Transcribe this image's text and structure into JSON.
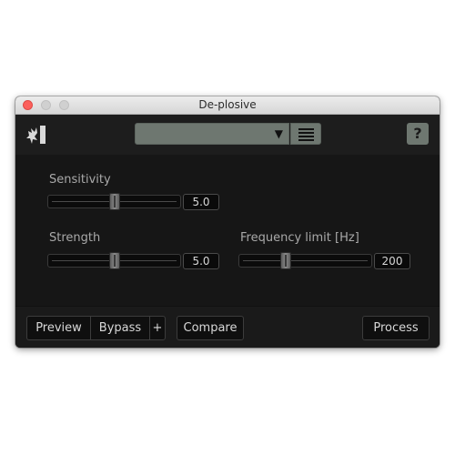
{
  "window": {
    "title": "De-plosive"
  },
  "toolbar": {
    "preset_value": "",
    "preset_arrow": "▼",
    "help_label": "?"
  },
  "controls": {
    "sensitivity": {
      "label": "Sensitivity",
      "value": "5.0",
      "level": 0.5
    },
    "strength": {
      "label": "Strength",
      "value": "5.0",
      "level": 0.5
    },
    "frequency_limit": {
      "label": "Frequency limit [Hz]",
      "value": "200",
      "level": 0.35
    }
  },
  "bottombar": {
    "preview_label": "Preview",
    "bypass_label": "Bypass",
    "plus_label": "+",
    "compare_label": "Compare",
    "process_label": "Process"
  },
  "colors": {
    "accent": "#6e7770",
    "background": "#161616",
    "close_button": "#fc605c"
  },
  "icons": {
    "logo": "deplosive-logo-icon",
    "preset_menu": "hamburger-list-icon"
  }
}
